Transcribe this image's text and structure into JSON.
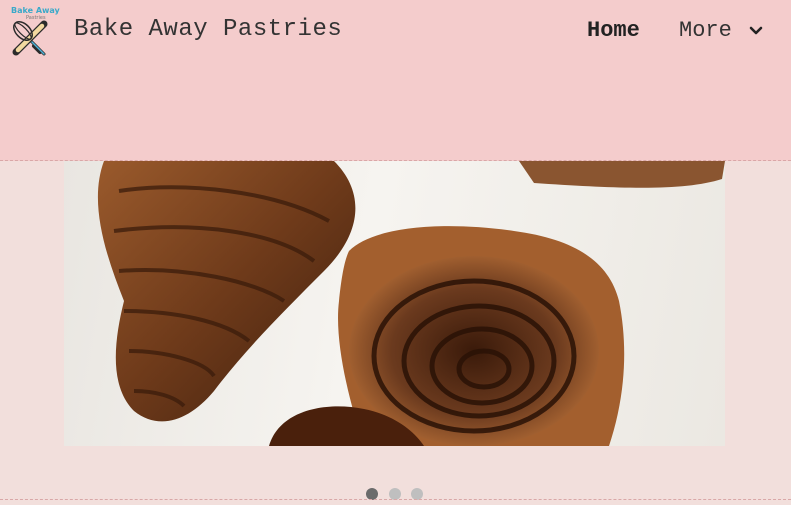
{
  "header": {
    "logo_text": "Bake Away",
    "logo_subtext": "Pastries",
    "brand_name": "Bake Away Pastries",
    "nav": {
      "home_label": "Home",
      "more_label": "More"
    }
  },
  "carousel": {
    "slide_count": 3,
    "active_index": 0
  },
  "colors": {
    "header_bg": "#f4cccc",
    "page_bg": "#f2dfdc",
    "dot_active": "#6b6b6b",
    "dot_inactive": "#bfbfbf"
  }
}
